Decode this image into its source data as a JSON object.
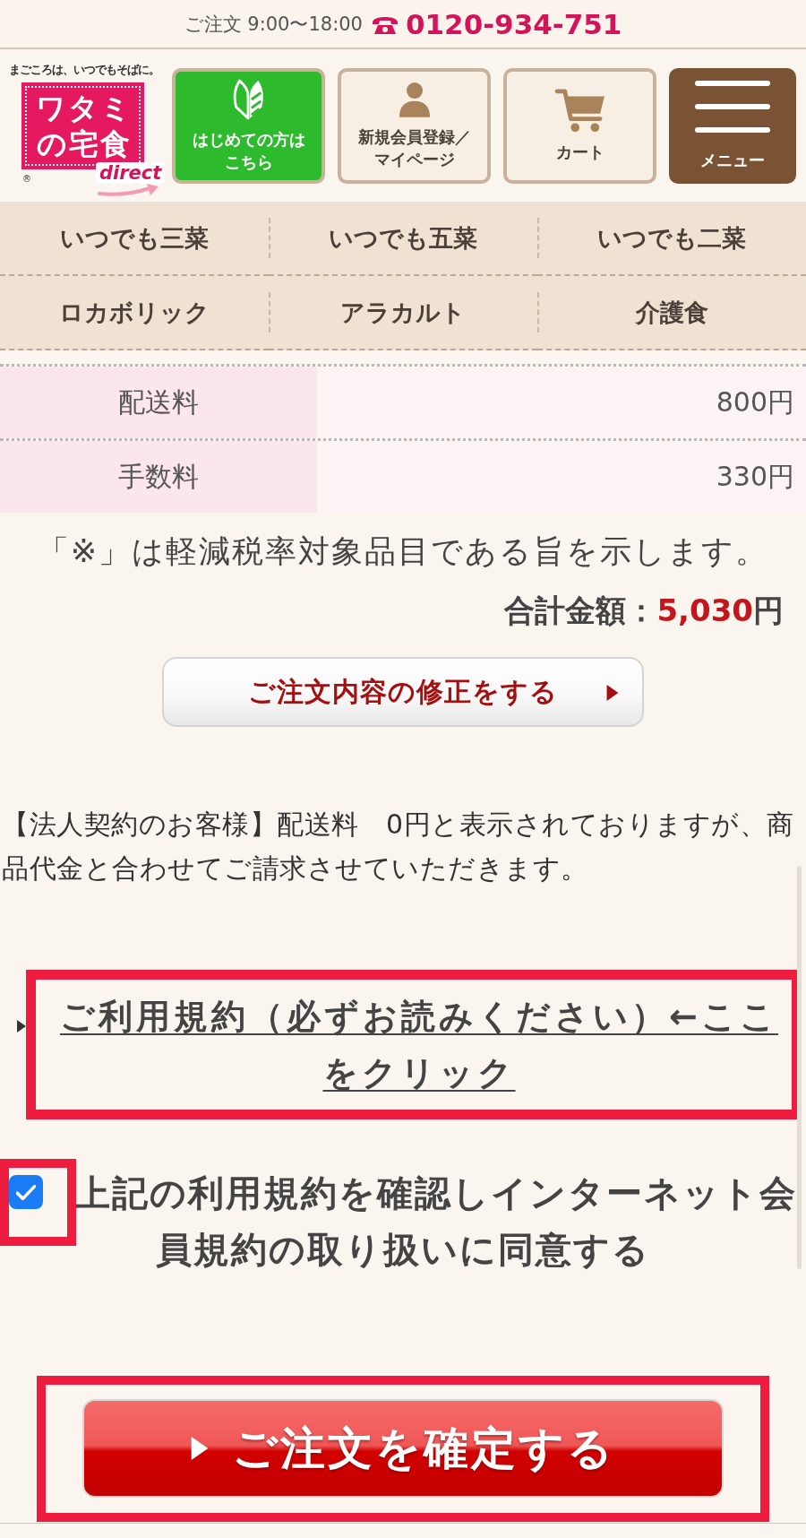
{
  "top_bar": {
    "hours": "ご注文 9:00〜18:00",
    "phone": "0120-934-751"
  },
  "logo": {
    "tagline": "まごころは、いつでもそばに。",
    "wordmark": "ワタミの宅食",
    "subtitle": "direct",
    "mark": "®"
  },
  "header_buttons": [
    {
      "kind": "beginner",
      "label": "はじめての方はこちら"
    },
    {
      "kind": "member",
      "label": "新規会員登録／マイページ"
    },
    {
      "kind": "cart",
      "label": "カート"
    },
    {
      "kind": "menu",
      "label": "メニュー"
    }
  ],
  "nav": [
    {
      "label": "いつでも三菜"
    },
    {
      "label": "いつでも五菜"
    },
    {
      "label": "いつでも二菜"
    },
    {
      "label": "ロカボリック"
    },
    {
      "label": "アラカルト"
    },
    {
      "label": "介護食"
    }
  ],
  "fees": [
    {
      "label": "配送料",
      "value": "800円"
    },
    {
      "label": "手数料",
      "value": "330円"
    }
  ],
  "tax_note": "「※」は軽減税率対象品目である旨を示します。",
  "total": {
    "label": "合計金額：",
    "amount": "5,030",
    "unit": "円"
  },
  "edit_button": {
    "label": "ご注文内容の修正をする"
  },
  "corporate_note": "【法人契約のお客様】配送料　0円と表示されておりますが、商品代金と合わせてご請求させていただきます。",
  "terms_link": {
    "label": "ご利用規約（必ずお読みください）←ここをクリック",
    "highlighted": true
  },
  "agreement": {
    "label": "上記の利用規約を確認しインターネット会員規約の取り扱いに同意する",
    "checked": true,
    "highlighted": true
  },
  "confirm_button": {
    "label": "ご注文を確定する",
    "highlighted": true
  }
}
